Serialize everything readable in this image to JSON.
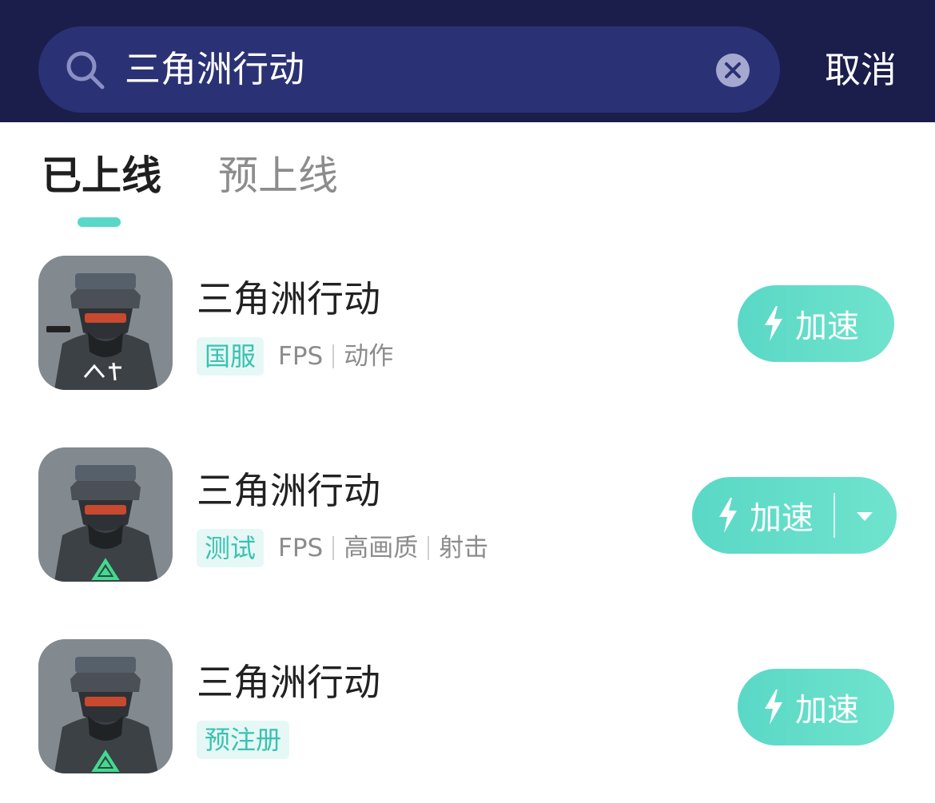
{
  "search": {
    "query": "三角洲行动",
    "cancel_label": "取消"
  },
  "tabs": [
    {
      "label": "已上线",
      "active": true
    },
    {
      "label": "预上线",
      "active": false
    }
  ],
  "results": [
    {
      "title": "三角洲行动",
      "tag": "国服",
      "meta": [
        "FPS",
        "动作"
      ],
      "button_label": "加速",
      "has_dropdown": false
    },
    {
      "title": "三角洲行动",
      "tag": "测试",
      "meta": [
        "FPS",
        "高画质",
        "射击"
      ],
      "button_label": "加速",
      "has_dropdown": true
    },
    {
      "title": "三角洲行动",
      "tag": "预注册",
      "meta": [],
      "button_label": "加速",
      "has_dropdown": false
    }
  ],
  "colors": {
    "header_bg": "#1b1d4b",
    "search_bg": "#2b3175",
    "accent": "#59d8c8",
    "tag_bg": "#e5f8f6",
    "tag_text": "#39c2b0"
  }
}
